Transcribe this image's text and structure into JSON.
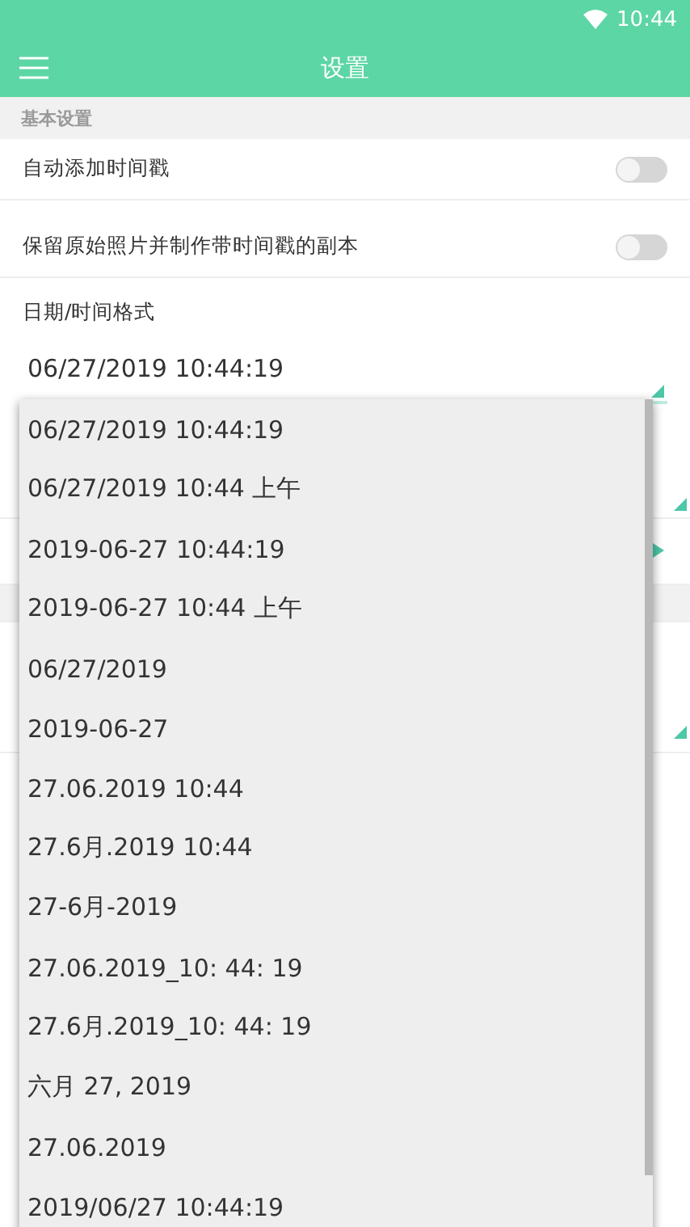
{
  "status_bar": {
    "time": "10:44"
  },
  "toolbar": {
    "title": "设置"
  },
  "section": {
    "title": "基本设置"
  },
  "toggles": [
    {
      "label": "自动添加时间戳",
      "on": false
    },
    {
      "label": "保留原始照片并制作带时间戳的副本",
      "on": false
    }
  ],
  "format": {
    "label": "日期/时间格式",
    "value": "06/27/2019 10:44:19"
  },
  "dropdown": {
    "options": [
      "06/27/2019 10:44:19",
      "06/27/2019 10:44 上午",
      "2019-06-27 10:44:19",
      "2019-06-27 10:44 上午",
      "06/27/2019",
      "2019-06-27",
      "27.06.2019 10:44",
      "27.6月.2019 10:44",
      "27-6月-2019",
      "27.06.2019_10: 44: 19",
      "27.6月.2019_10: 44: 19",
      "六月 27, 2019",
      "27.06.2019",
      "2019/06/27 10:44:19"
    ]
  }
}
